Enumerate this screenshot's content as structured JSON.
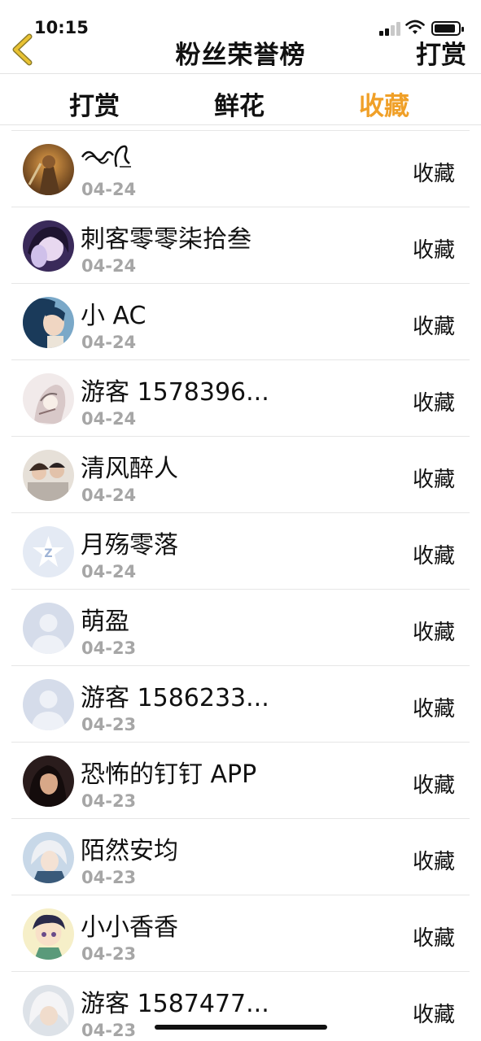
{
  "status_bar": {
    "time": "10:15",
    "battery_icon": "battery-icon",
    "wifi_icon": "wifi-icon",
    "signal_icon": "signal-icon"
  },
  "nav": {
    "back_icon": "chevron-left-icon",
    "title": "粉丝荣誉榜",
    "action_label": "打赏",
    "accent_color": "#e9c233"
  },
  "tabs": [
    {
      "label": "打赏",
      "active": false
    },
    {
      "label": "鲜花",
      "active": false
    },
    {
      "label": "收藏",
      "active": true
    }
  ],
  "colors": {
    "active_tab": "#f0a028",
    "date_text": "#a6a6a6",
    "divider": "#e6e6e6"
  },
  "fans": [
    {
      "name": "",
      "name_icon": "wave-signature-icon",
      "date": "04-24",
      "kind": "收藏",
      "avatar": "warrior"
    },
    {
      "name": "刺客零零柒拾叁",
      "date": "04-24",
      "kind": "收藏",
      "avatar": "purple-girl"
    },
    {
      "name": "小 AC",
      "date": "04-24",
      "kind": "收藏",
      "avatar": "blue-girl"
    },
    {
      "name": "游客 1578396...",
      "date": "04-24",
      "kind": "收藏",
      "avatar": "sketch-girl"
    },
    {
      "name": "清风醉人",
      "date": "04-24",
      "kind": "收藏",
      "avatar": "couple-photo"
    },
    {
      "name": "月殇零落",
      "date": "04-24",
      "kind": "收藏",
      "avatar": "qq-default"
    },
    {
      "name": "萌盈",
      "date": "04-23",
      "kind": "收藏",
      "avatar": "default"
    },
    {
      "name": "游客 1586233...",
      "date": "04-23",
      "kind": "收藏",
      "avatar": "default"
    },
    {
      "name": "恐怖的钉钉 APP",
      "date": "04-23",
      "kind": "收藏",
      "avatar": "dark-girl"
    },
    {
      "name": "陌然安均",
      "date": "04-23",
      "kind": "收藏",
      "avatar": "silver-boy"
    },
    {
      "name": "小小香香",
      "date": "04-23",
      "kind": "收藏",
      "avatar": "chibi"
    },
    {
      "name": "游客 1587477...",
      "date": "04-23",
      "kind": "收藏",
      "avatar": "white-hair"
    }
  ]
}
